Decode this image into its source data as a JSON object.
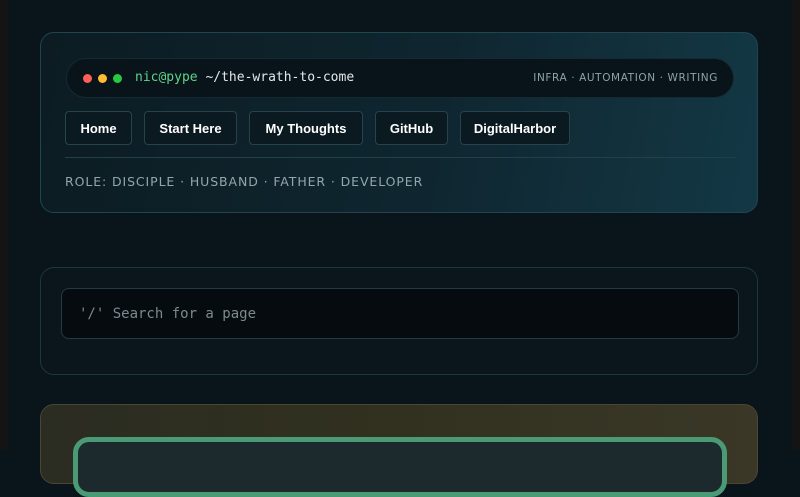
{
  "terminal": {
    "user_host": "nic@pype",
    "path": "~/the-wrath-to-come",
    "tagline": "INFRA · AUTOMATION · WRITING"
  },
  "nav": {
    "items": [
      {
        "label": "Home"
      },
      {
        "label": "Start Here"
      },
      {
        "label": "My Thoughts"
      },
      {
        "label": "GitHub"
      },
      {
        "label": "DigitalHarbor"
      }
    ]
  },
  "role_line": "ROLE: DISCIPLE · HUSBAND · FATHER · DEVELOPER",
  "search": {
    "placeholder": "'/' Search for a page",
    "value": ""
  },
  "colors": {
    "background": "#0a141b",
    "accent_green": "#5fd38a",
    "dot_red": "#ff5f57",
    "dot_yellow": "#febc2e",
    "dot_green": "#28c840",
    "frame_green": "#4b9a76"
  }
}
